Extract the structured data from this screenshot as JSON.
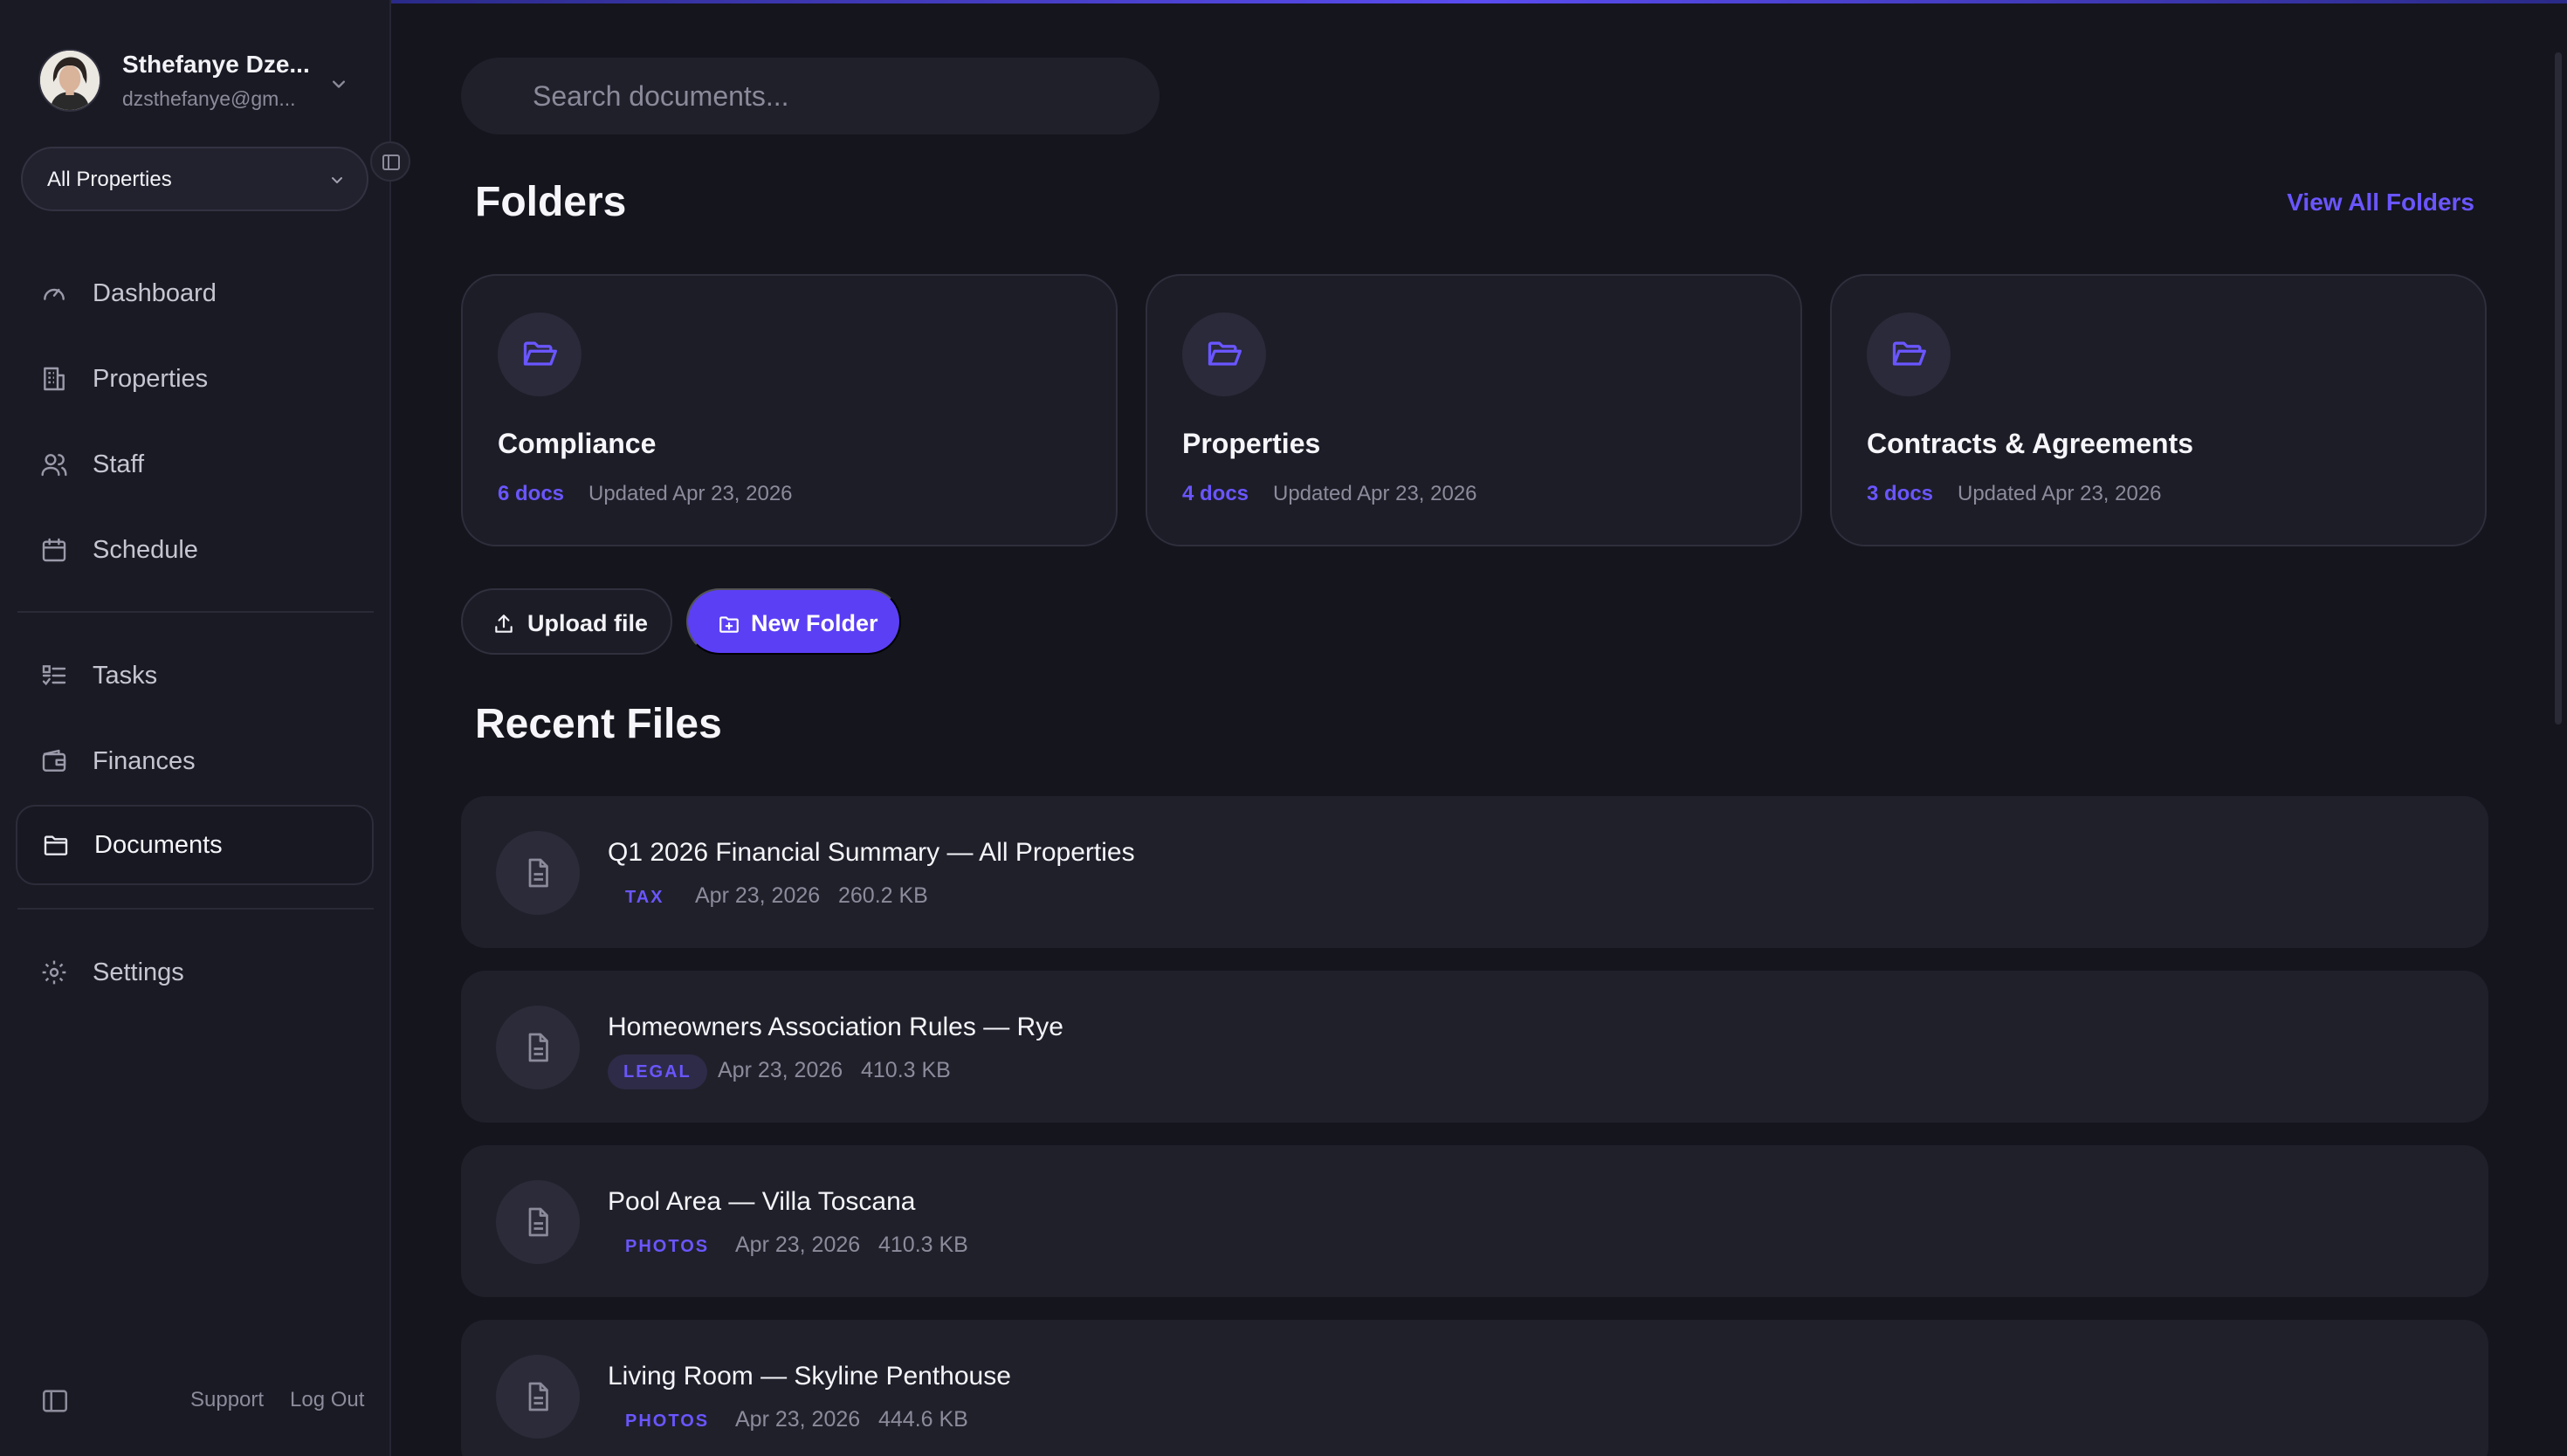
{
  "user": {
    "name": "Sthefanye Dze...",
    "email": "dzsthefanye@gm..."
  },
  "property_selector": {
    "selected": "All Properties"
  },
  "nav": {
    "dashboard": "Dashboard",
    "properties": "Properties",
    "staff": "Staff",
    "schedule": "Schedule",
    "tasks": "Tasks",
    "finances": "Finances",
    "documents": "Documents",
    "settings": "Settings"
  },
  "footer": {
    "support": "Support",
    "logout": "Log Out"
  },
  "search": {
    "placeholder": "Search documents..."
  },
  "folders": {
    "title": "Folders",
    "view_all": "View All Folders",
    "items": [
      {
        "name": "Compliance",
        "docs": "6 docs",
        "updated": "Updated Apr 23, 2026"
      },
      {
        "name": "Properties",
        "docs": "4 docs",
        "updated": "Updated Apr 23, 2026"
      },
      {
        "name": "Contracts & Agreements",
        "docs": "3 docs",
        "updated": "Updated Apr 23, 2026"
      }
    ]
  },
  "actions": {
    "upload": "Upload file",
    "new_folder": "New Folder"
  },
  "recent": {
    "title": "Recent Files",
    "items": [
      {
        "name": "Q1 2026 Financial Summary — All Properties",
        "tag": "TAX",
        "date": "Apr 23, 2026",
        "size": "260.2 KB"
      },
      {
        "name": "Homeowners Association Rules — Rye",
        "tag": "LEGAL",
        "date": "Apr 23, 2026",
        "size": "410.3 KB"
      },
      {
        "name": "Pool Area — Villa Toscana",
        "tag": "PHOTOS",
        "date": "Apr 23, 2026",
        "size": "410.3 KB"
      },
      {
        "name": "Living Room — Skyline Penthouse",
        "tag": "PHOTOS",
        "date": "Apr 23, 2026",
        "size": "444.6 KB"
      }
    ]
  },
  "colors": {
    "accent": "#5b3ff5",
    "accent_text": "#6a56ff",
    "background": "#15151e",
    "sidebar": "#1a1a24"
  }
}
